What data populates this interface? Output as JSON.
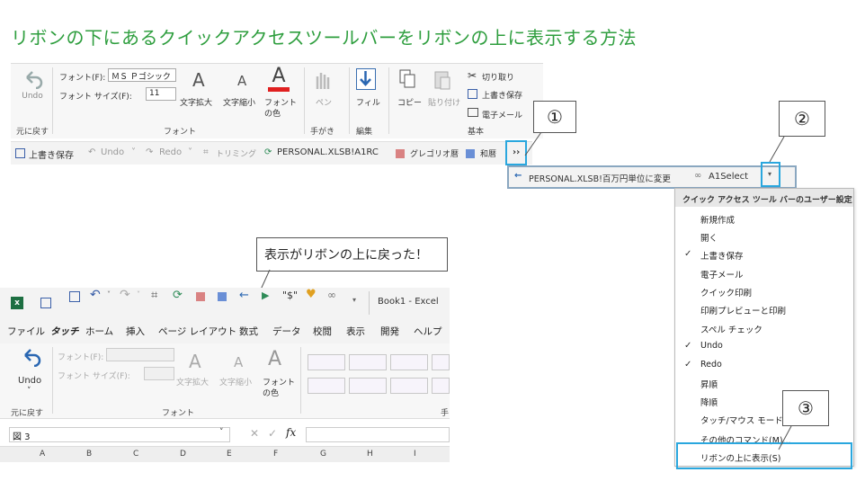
{
  "title": "リボンの下にあるクイックアクセスツールバーをリボンの上に表示する方法",
  "ribbon": {
    "undo_label": "Undo",
    "group_undo": "元に戻す",
    "font_label": "フォント(F):",
    "font_value": "ＭＳ Ｐゴシック",
    "size_label": "フォント サイズ(F):",
    "size_value": "11",
    "grow": "文字拡大",
    "shrink": "文字縮小",
    "font_color_1": "フォント",
    "font_color_2": "の色",
    "group_font": "フォント",
    "pen": "ペン",
    "group_handwrite": "手がき",
    "fill": "フィル",
    "group_edit": "編集",
    "copy": "コピー",
    "paste": "貼り付け",
    "cut": "切り取り",
    "overwrite": "上書き保存",
    "email": "電子メール",
    "group_basic": "基本"
  },
  "qat_bottom": {
    "save": "上書き保存",
    "undo": "Undo",
    "redo": "Redo",
    "trim": "トリミング",
    "personal": "PERSONAL.XLSB!A1RC",
    "gregorian": "グレゴリオ暦",
    "wareki": "和暦",
    "more": "››"
  },
  "qat_overflow": {
    "personal": "PERSONAL.XLSB!百万円単位に変更",
    "a1select": "A1Select"
  },
  "callouts": {
    "c1": "①",
    "c2": "②",
    "c3": "③",
    "note": "表示がリボンの上に戻った！"
  },
  "menu": {
    "header": "クイック アクセス ツール バーのユーザー設定",
    "items": [
      "新規作成",
      "開く",
      "上書き保存",
      "電子メール",
      "クイック印刷",
      "印刷プレビューと印刷",
      "スペル チェック",
      "Undo",
      "Redo",
      "昇順",
      "降順",
      "タッチ/マウス モードの切",
      "その他のコマンド(M)...",
      "リボンの上に表示(S)"
    ]
  },
  "excel": {
    "book": "Book1 - Excel",
    "tabs": [
      "ファイル",
      "タッチ",
      "ホーム",
      "挿入",
      "ページ レイアウト",
      "数式",
      "データ",
      "校閲",
      "表示",
      "開発",
      "ヘルプ"
    ],
    "undo": "Undo",
    "group_undo": "元に戻す",
    "font_label": "フォント(F):",
    "size_label": "フォント サイズ(F):",
    "grow": "文字拡大",
    "shrink": "文字縮小",
    "font_color_1": "フォント",
    "font_color_2": "の色",
    "group_font": "フォント",
    "group_right": "手",
    "namebox": "図 3",
    "fx": "fx",
    "columns": [
      "A",
      "B",
      "C",
      "D",
      "E",
      "F",
      "G",
      "H",
      "I"
    ]
  },
  "colors": {
    "title_green": "#2e9e3e",
    "highlight_blue": "#2aa7de",
    "gregorian_swatch": "#d98282",
    "wareki_swatch": "#6a8fd6",
    "excel_green": "#1d6f42"
  }
}
